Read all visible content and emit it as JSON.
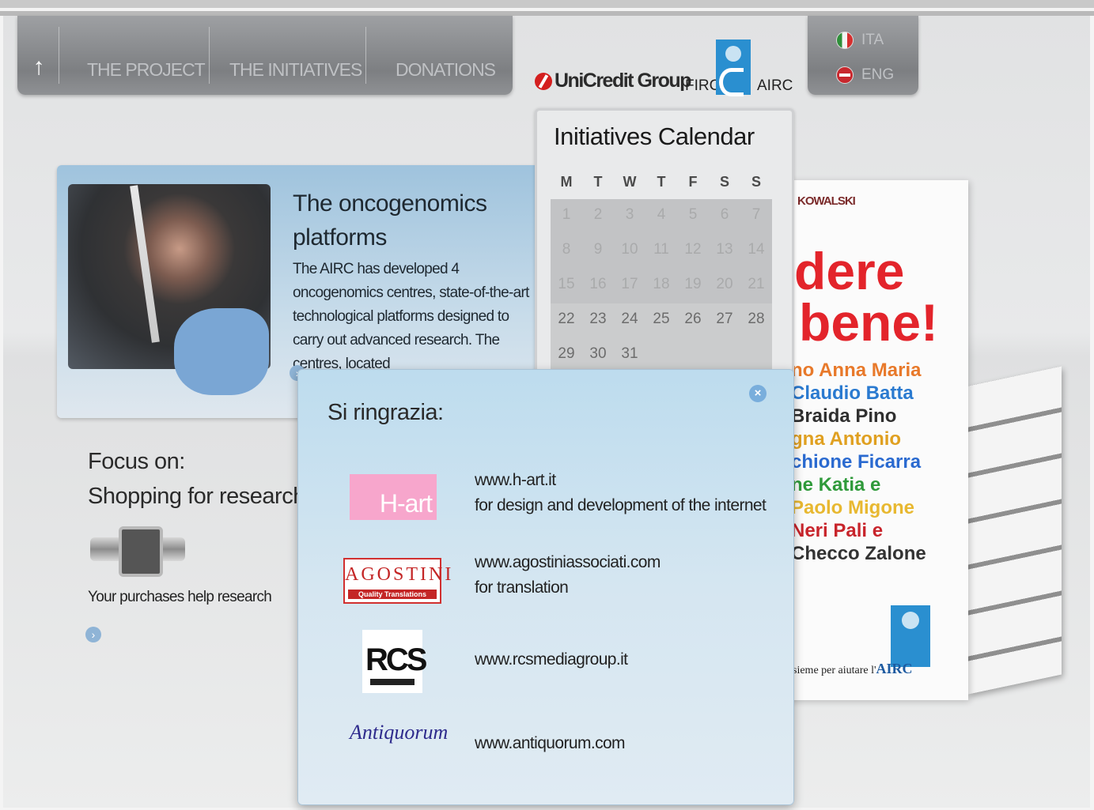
{
  "nav": {
    "home_icon": "home-arrow-icon",
    "items": [
      "THE PROJECT",
      "THE INITIATIVES",
      "DONATIONS"
    ]
  },
  "lang": {
    "ita": "ITA",
    "eng": "ENG"
  },
  "logos": {
    "unicredit": "UniCredit Group",
    "firc": "FIRC",
    "airc": "AIRC"
  },
  "feature": {
    "title": "The oncogenomics platforms",
    "text": "The AIRC has developed 4 oncogenomics centres, state-of-the-art technological platforms designed to carry out advanced research. The centres, located"
  },
  "focus": {
    "title_line1": "Focus on:",
    "title_line2": "Shopping for research",
    "subtitle": "Your purchases help research"
  },
  "calendar": {
    "title": "Initiatives Calendar",
    "weekdays": [
      "M",
      "T",
      "W",
      "T",
      "F",
      "S",
      "S"
    ],
    "weeks": [
      [
        "1",
        "2",
        "3",
        "4",
        "5",
        "6",
        "7"
      ],
      [
        "8",
        "9",
        "10",
        "11",
        "12",
        "13",
        "14"
      ],
      [
        "15",
        "16",
        "17",
        "18",
        "19",
        "20",
        "21"
      ],
      [
        "22",
        "23",
        "24",
        "25",
        "26",
        "27",
        "28"
      ],
      [
        "29",
        "30",
        "31",
        "",
        "",
        "",
        ""
      ]
    ]
  },
  "book": {
    "author": "KOWALSKI",
    "line1": "dere",
    "line2": "bene!",
    "names": [
      "no Anna Maria",
      "Claudio Batta",
      "Braida Pino",
      "gna Antonio",
      "chione Ficarra",
      "ne Katia e",
      "Paolo Migone",
      "Neri Pali e",
      "Checco Zalone"
    ],
    "footer_prefix": "sieme per aiutare l'",
    "footer_brand": "AIRC"
  },
  "modal": {
    "title": "Si ringrazia:",
    "close_icon": "close-icon",
    "sponsors": [
      {
        "logo": "H-art",
        "line1": "www.h-art.it",
        "line2": "for design and development of the internet"
      },
      {
        "logo": "AGOSTINI",
        "logo_sub": "Quality Translations",
        "line1": "www.agostiniassociati.com",
        "line2": "for translation"
      },
      {
        "logo": "RCS",
        "line1": "www.rcsmediagroup.it",
        "line2": ""
      },
      {
        "logo": "Antiquorum",
        "line1": "www.antiquorum.com",
        "line2": ""
      }
    ]
  },
  "colors": {
    "accent_blue": "#2a8fd0",
    "brand_red": "#d41f1f",
    "modal_bg": "#d5e6f1"
  }
}
